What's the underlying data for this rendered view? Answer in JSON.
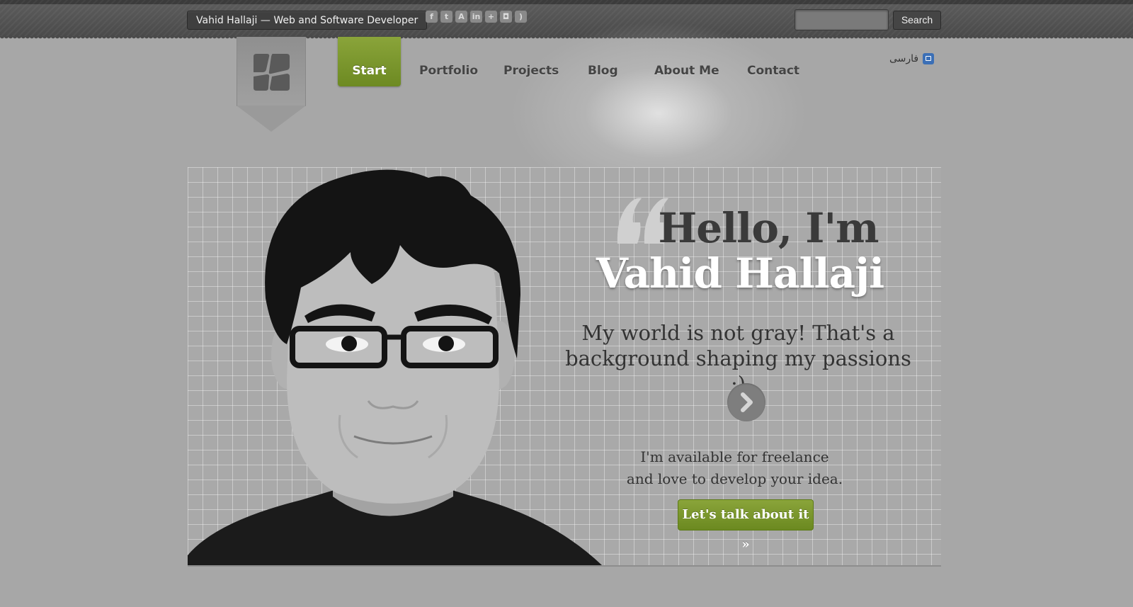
{
  "topbar": {
    "site_title": "Vahid Hallaji — Web and Software Developer",
    "social_icons": [
      "facebook-icon",
      "twitter-icon",
      "app-icon",
      "linkedin-icon",
      "google-plus-icon",
      "instagram-icon",
      "rss-icon"
    ],
    "search": {
      "value": "",
      "placeholder": "",
      "button_label": "Search"
    }
  },
  "nav": {
    "items": [
      {
        "label": "Start",
        "active": true
      },
      {
        "label": "Portfolio",
        "active": false
      },
      {
        "label": "Projects",
        "active": false
      },
      {
        "label": "Blog",
        "active": false
      },
      {
        "label": "About Me",
        "active": false
      },
      {
        "label": "Contact",
        "active": false
      }
    ],
    "language_label": "فارسی"
  },
  "hero": {
    "greeting_line1": "Hello, I'm",
    "greeting_line2": "Vahid Hallaji",
    "tagline": "My world is not gray! That's a background shaping my passions :)",
    "freelance_line1": "I'm available for freelance",
    "freelance_line2": "and love to develop your idea.",
    "cta_label": "Let's talk about it »"
  },
  "colors": {
    "accent_green": "#7a9a2c",
    "background": "#a7a7a7",
    "topbar": "#4a4a4a",
    "language_icon": "#3b6fb6"
  }
}
